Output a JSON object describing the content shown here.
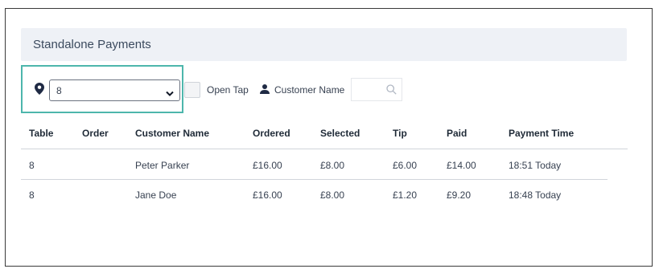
{
  "panel": {
    "title": "Standalone Payments"
  },
  "filters": {
    "location_select": {
      "value": "8"
    },
    "open_tap_label": "Open Tap",
    "customer_name_label": "Customer Name",
    "search_placeholder": ""
  },
  "colors": {
    "highlight": "#4db6ac",
    "header_bg": "#eef1f6",
    "icon": "#1f2a44"
  },
  "icons": [
    "location-pin-icon",
    "chevron-down-icon",
    "person-icon",
    "search-icon"
  ],
  "table": {
    "columns": [
      "Table",
      "Order",
      "Customer Name",
      "Ordered",
      "Selected",
      "Tip",
      "Paid",
      "Payment Time"
    ],
    "rows": [
      {
        "table": "8",
        "order": "",
        "customer_name": "Peter Parker",
        "ordered": "£16.00",
        "selected": "£8.00",
        "tip": "£6.00",
        "paid": "£14.00",
        "payment_time": "18:51 Today"
      },
      {
        "table": "8",
        "order": "",
        "customer_name": "Jane Doe",
        "ordered": "£16.00",
        "selected": "£8.00",
        "tip": "£1.20",
        "paid": "£9.20",
        "payment_time": "18:48 Today"
      }
    ]
  }
}
